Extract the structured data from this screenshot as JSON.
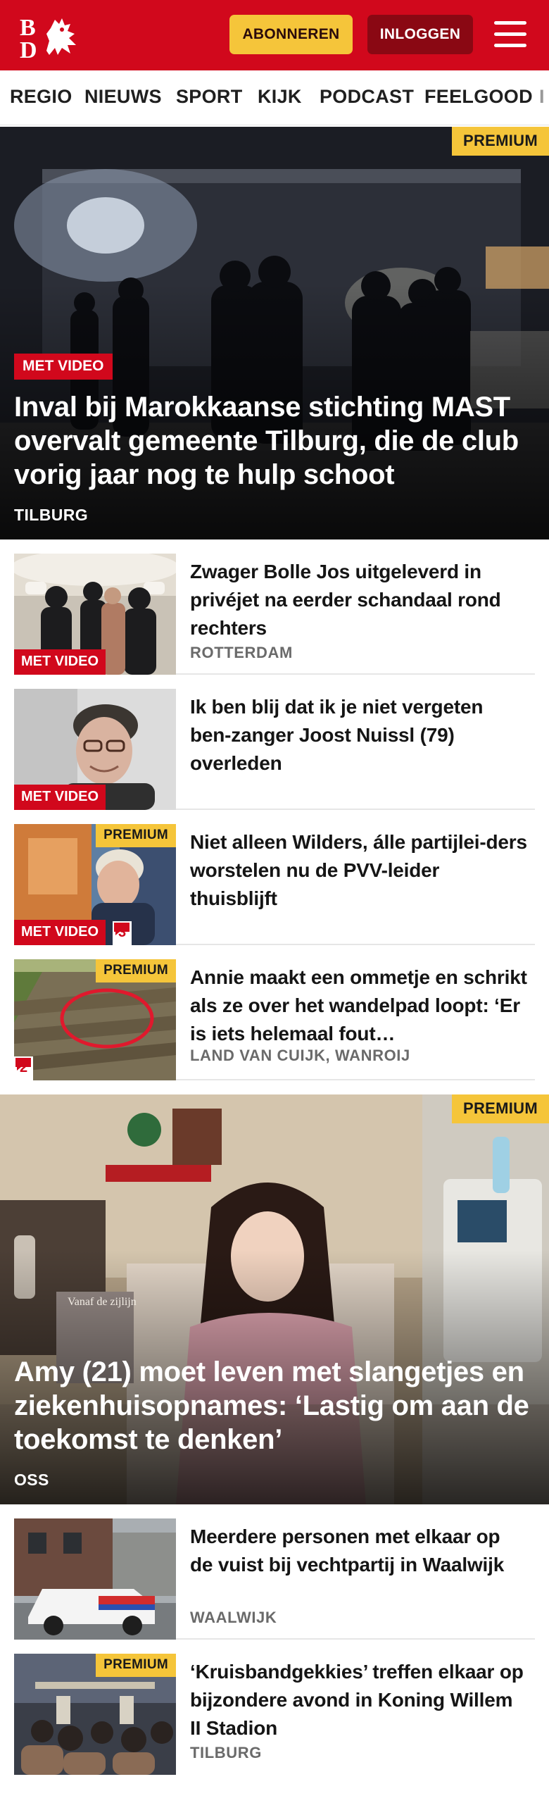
{
  "brand": {
    "logo_text": "BD",
    "colors": {
      "brand_red": "#d1081c",
      "subscribe_yellow": "#f5c53a",
      "login_dark_red": "#8a0813"
    }
  },
  "header": {
    "subscribe_label": "ABONNEREN",
    "login_label": "INLOGGEN",
    "menu_icon": "hamburger-menu-icon"
  },
  "nav": {
    "items": [
      "REGIO",
      "NIEUWS",
      "SPORT",
      "KIJK",
      "PODCAST",
      "FEELGOOD",
      "I"
    ]
  },
  "hero1": {
    "badge": "PREMIUM",
    "video_label": "MET VIDEO",
    "title": "Inval bij Marokkaanse stichting MAST overvalt gemeente Tilburg, die de club vorig jaar nog te hulp schoot",
    "location": "TILBURG"
  },
  "articles": [
    {
      "title": "Zwager Bolle Jos uitgeleverd in privéjet na eerder schandaal rond rechters",
      "location": "ROTTERDAM",
      "video_label": "MET VIDEO"
    },
    {
      "title": "Ik ben blij dat ik je niet vergeten ben-zanger Joost Nuissl (79) overleden",
      "video_label": "MET VIDEO"
    },
    {
      "title": "Niet alleen Wilders, álle partijlei-ders worstelen nu de PVV-leider thuisblijft",
      "badge": "PREMIUM",
      "video_label": "MET VIDEO",
      "comments": "3"
    },
    {
      "title": "Annie maakt een ommetje en schrikt als ze over het wandelpad loopt: ‘Er is iets helemaal fout…",
      "location": "LAND VAN CUIJK, WANROIJ",
      "badge": "PREMIUM",
      "comments": "2"
    }
  ],
  "hero2": {
    "badge": "PREMIUM",
    "book_text": "Vanaf de zijlijn",
    "title": "Amy (21) moet leven met slangetjes en ziekenhuisopnames: ‘Lastig om aan de toekomst te denken’",
    "location": "OSS"
  },
  "articles2": [
    {
      "title": "Meerdere personen met elkaar op de vuist bij vechtpartij in Waalwijk",
      "location": "WAALWIJK"
    },
    {
      "title": "‘Kruisbandgekkies’ treffen elkaar op bijzondere avond in Koning Willem II Stadion",
      "location": "TILBURG",
      "badge": "PREMIUM"
    }
  ]
}
